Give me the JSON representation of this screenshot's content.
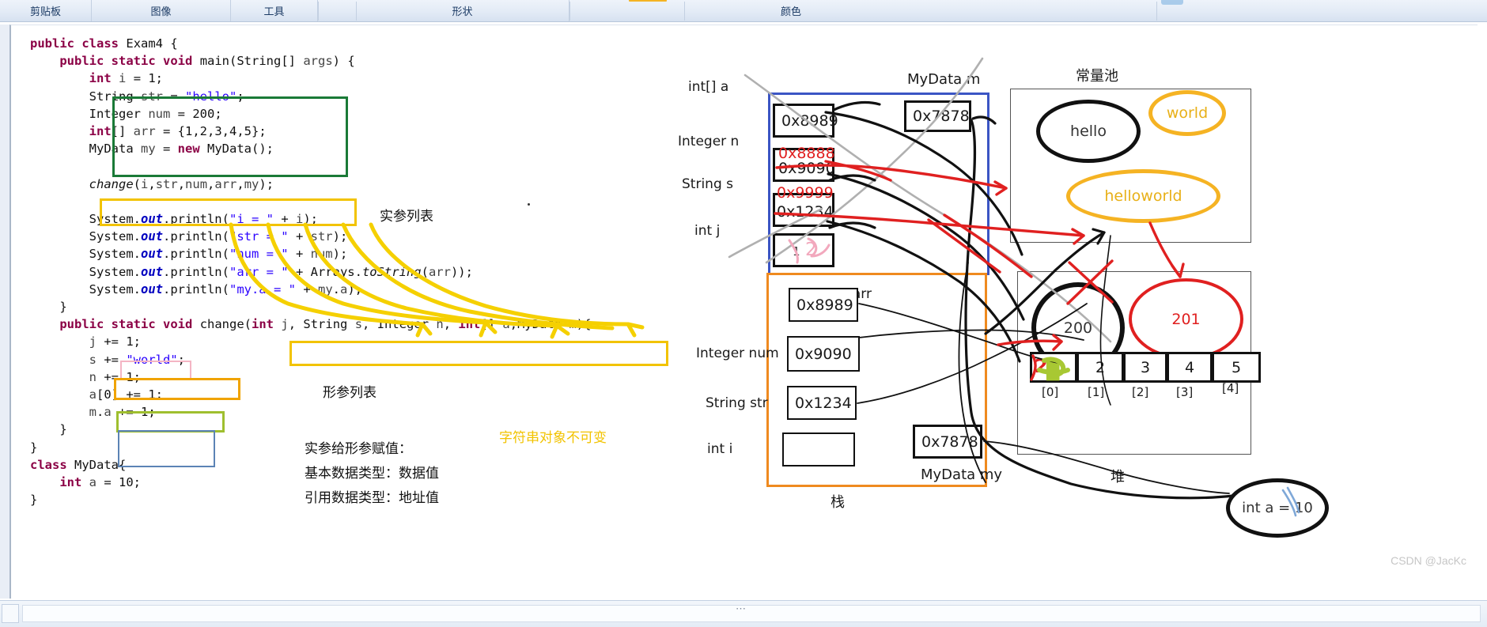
{
  "ribbon": {
    "groups": [
      {
        "label": "剪贴板",
        "name": "clipboard"
      },
      {
        "label": "图像",
        "name": "image"
      },
      {
        "label": "工具",
        "name": "tools"
      },
      {
        "label": "形状",
        "name": "shapes"
      },
      {
        "label": "颜色",
        "name": "colors"
      }
    ]
  },
  "code": {
    "lines": [
      "public class Exam4 {",
      "    public static void main(String[] args) {",
      "        int i = 1;",
      "        String str = \"hello\";",
      "        Integer num = 200;",
      "        int[] arr = {1,2,3,4,5};",
      "        MyData my = new MyData();",
      "",
      "        change(i,str,num,arr,my);",
      "",
      "        System.out.println(\"i = \" + i);",
      "        System.out.println(\"str = \" + str);",
      "        System.out.println(\"num = \" + num);",
      "        System.out.println(\"arr = \" + Arrays.toString(arr));",
      "        System.out.println(\"my.a = \" + my.a);",
      "    }",
      "    public static void change(int j, String s, Integer n, int[] a,MyData m){",
      "        j += 1;",
      "        s += \"world\";",
      "        n += 1;",
      "        a[0] += 1;",
      "        m.a += 1;",
      "    }",
      "}",
      "class MyData{",
      "    int a = 10;",
      "}"
    ]
  },
  "annotations": {
    "actual_args_label": "实参列表",
    "formal_args_label": "形参列表",
    "assign_label": "实参给形参赋值：",
    "primitive_label": "基本数据类型：数据值",
    "reference_label": "引用数据类型：地址值",
    "immutable_label": "字符串对象不可变"
  },
  "diagram": {
    "stack_label": "栈",
    "heap_label": "堆",
    "pool_label": "常量池",
    "change_frame_title": "MyData m",
    "main_frame_title": "MyData my",
    "change_frame": {
      "name": "change-stack-frame",
      "vars": [
        {
          "name": "int[]  a",
          "value": "0x8989",
          "old": "",
          "struck": false
        },
        {
          "name": "Integer n",
          "value": "0x9090",
          "old": "0x8888",
          "struck": true
        },
        {
          "name": "String  s",
          "value": "0x1234",
          "old": "0x9999",
          "struck": true
        },
        {
          "name": "int  j",
          "value": "1",
          "old": "",
          "struck": false,
          "overwrite": "2"
        }
      ],
      "extra_slot": "0x7878"
    },
    "main_frame": {
      "name": "main-stack-frame",
      "vars": [
        {
          "name": "int[]   arr",
          "value": "0x8989"
        },
        {
          "name": "Integer num",
          "value": "0x9090"
        },
        {
          "name": "String str",
          "value": "0x1234"
        },
        {
          "name": "int  i",
          "value": ""
        }
      ],
      "extra_slot": "0x7878"
    },
    "pool": {
      "hello": "hello",
      "world": "world",
      "helloworld": "helloworld"
    },
    "heap": {
      "integer_200": "200",
      "integer_201": "201",
      "array_values": [
        "2",
        "2",
        "3",
        "4",
        "5"
      ],
      "array_indices": [
        "[0]",
        "[1]",
        "[2]",
        "[3]",
        "[4]"
      ],
      "mydata_field": "int a = 10"
    }
  },
  "colors": {
    "green_box": "#1a7a37",
    "yellow_box": "#f2c300",
    "orange_box": "#f0a300",
    "pink_box": "#f4b5c4",
    "olive_box": "#9fbf2f",
    "blue_box": "#5b83b5",
    "frame_change": "#3b55c4",
    "frame_main": "#ef8a1f",
    "red_ink": "#e02020",
    "gold": "#f5b323"
  },
  "watermark": "CSDN @JacKc"
}
